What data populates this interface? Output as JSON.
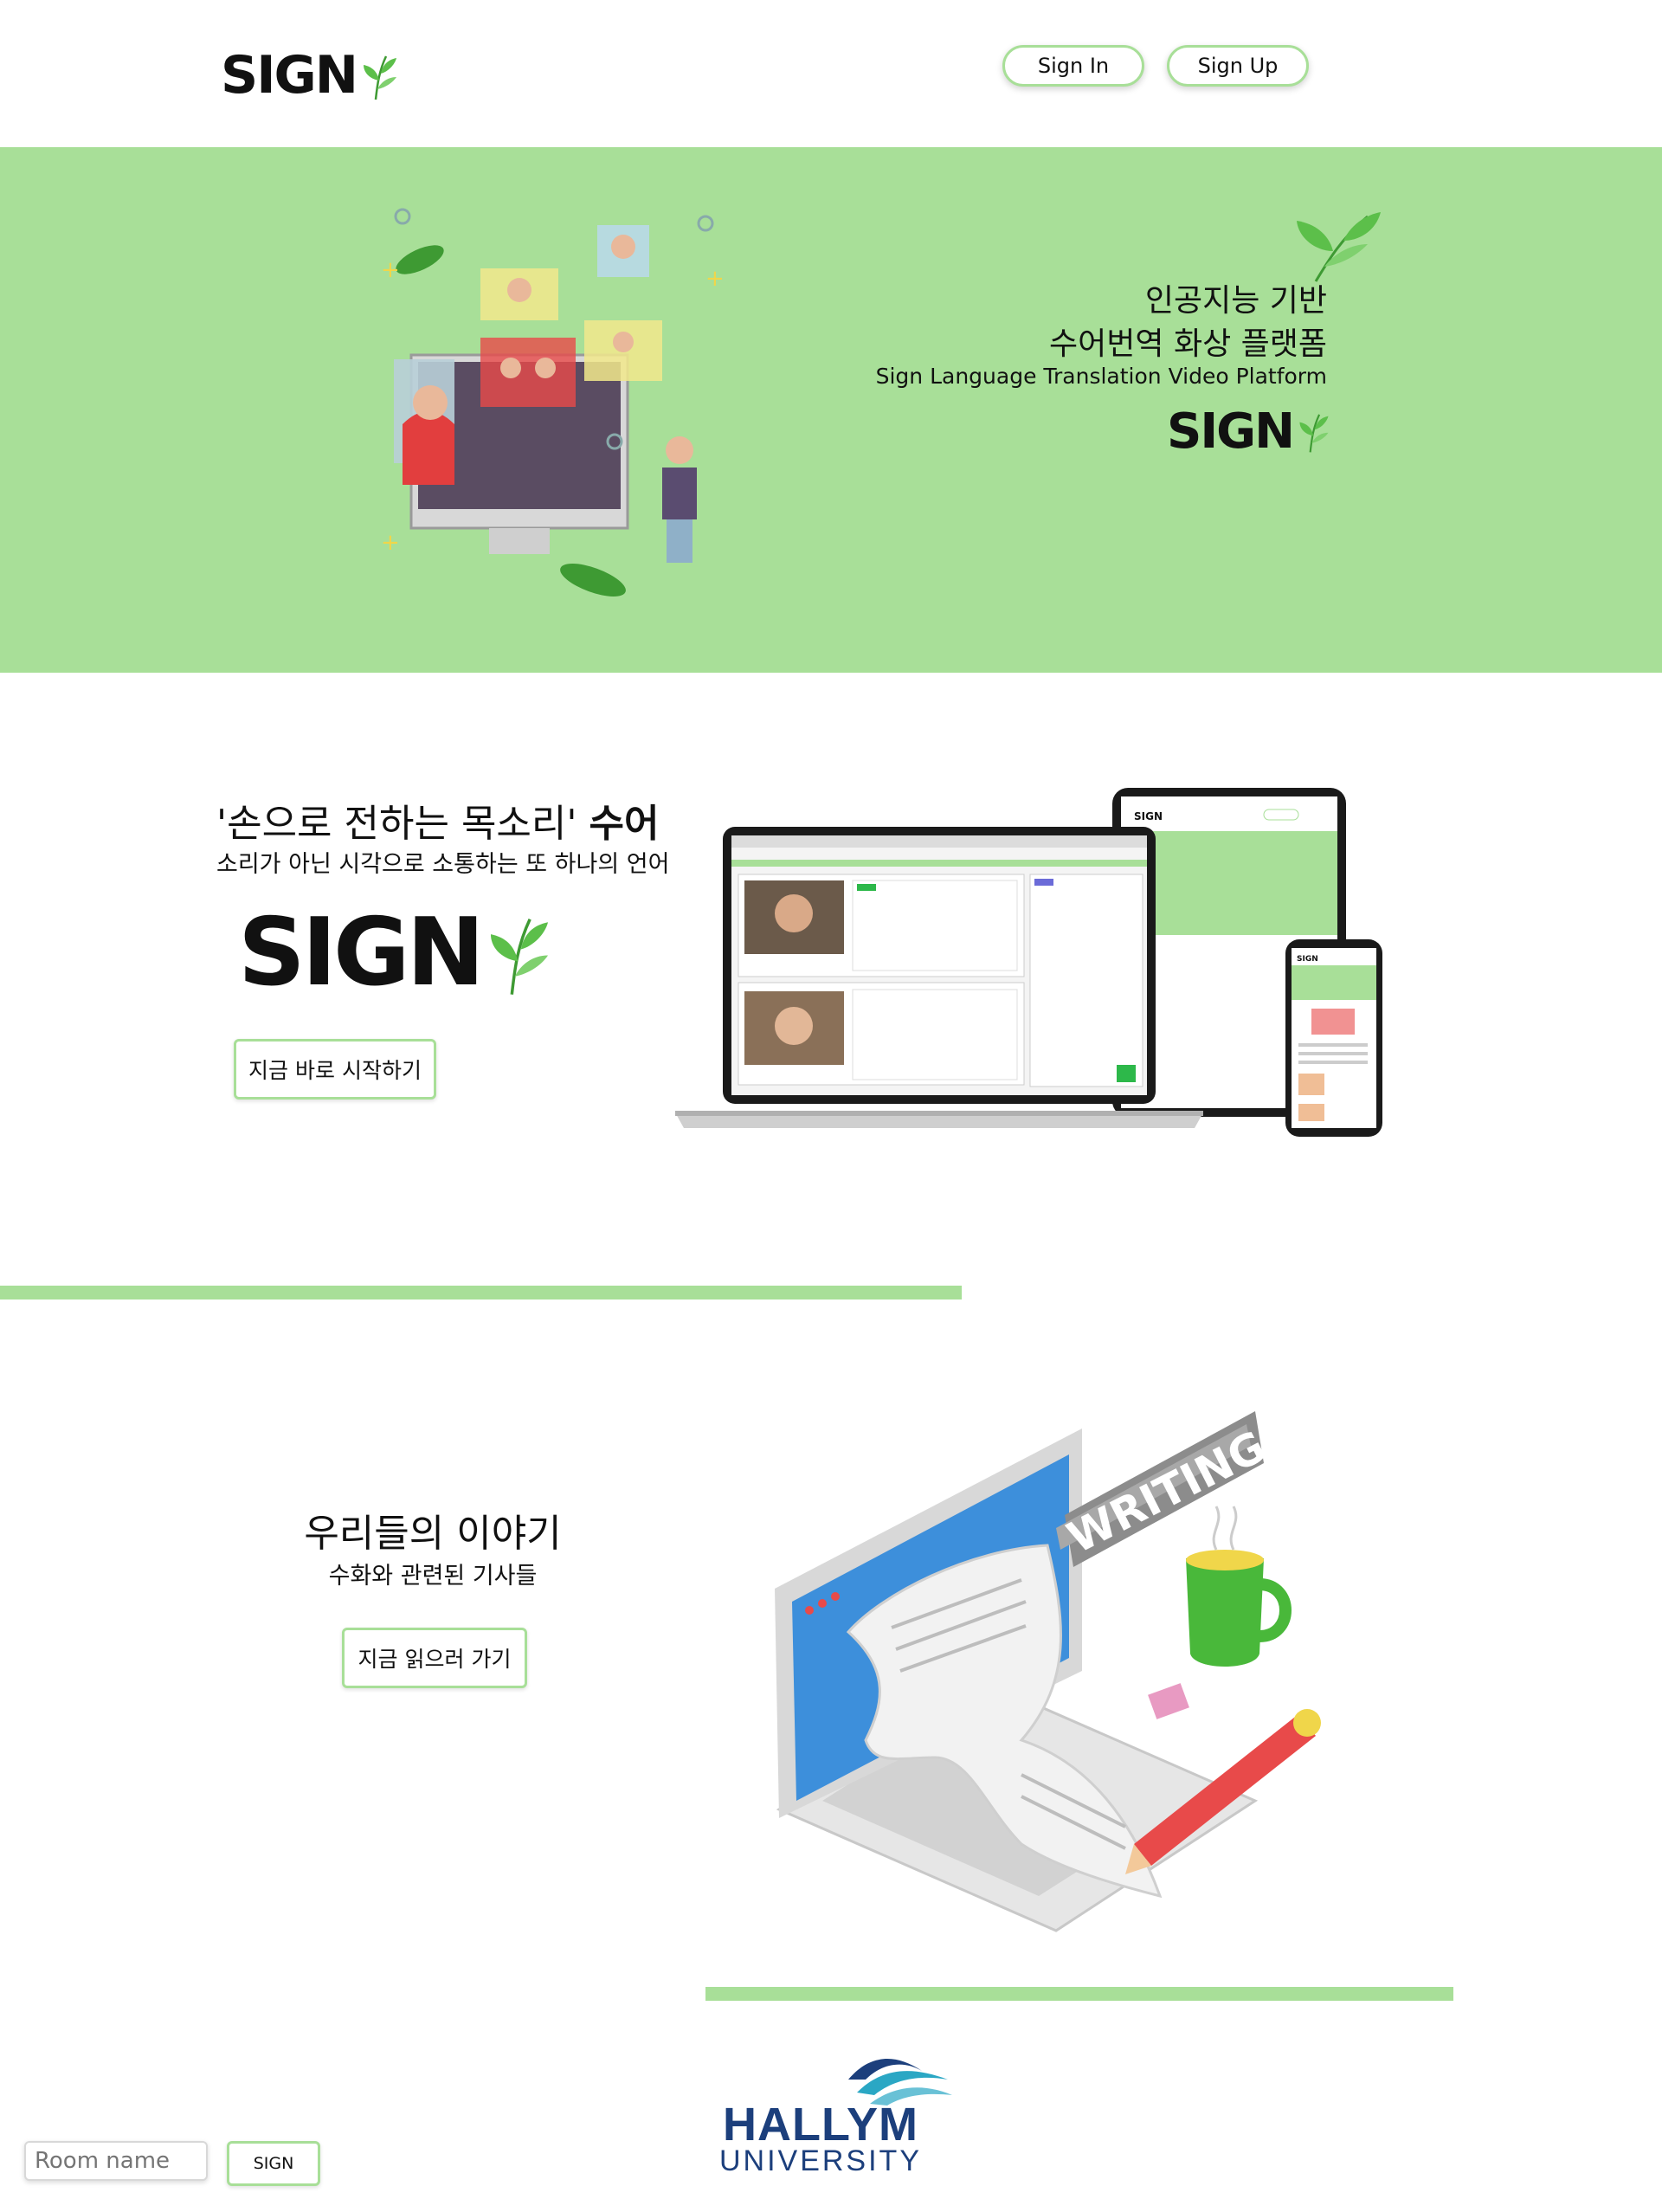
{
  "header": {
    "logo_text": "SIGN",
    "sign_in_label": "Sign In",
    "sign_up_label": "Sign Up"
  },
  "hero": {
    "title_line1": "인공지능 기반",
    "title_line2": "수어번역 화상 플랫폼",
    "subtitle_en": "Sign Language Translation Video Platform",
    "logo_text": "SIGN"
  },
  "section_sign": {
    "headline_normal": "'손으로 전하는 목소리'",
    "headline_bold": "수어",
    "subline": "소리가 아닌 시각으로 소통하는 또 하나의 언어",
    "logo_text": "SIGN",
    "cta_label": "지금 바로 시작하기",
    "mock_laptop_badge": "",
    "mock_tablet_logo": "SIGN",
    "mock_phone_logo": "SIGN"
  },
  "section_story": {
    "headline": "우리들의 이야기",
    "subline": "수화와 관련된 기사들",
    "cta_label": "지금 읽으러 가기",
    "sign_text": "WRITING"
  },
  "footer": {
    "univ_name": "HALLYM",
    "univ_sub": "UNIVERSITY",
    "room_placeholder": "Room name",
    "room_button": "SIGN"
  },
  "colors": {
    "accent_green": "#a8df98",
    "leaf_green": "#5cbf4a",
    "hallym_navy": "#1c3f7c",
    "hallym_teal": "#2aa7c4"
  }
}
